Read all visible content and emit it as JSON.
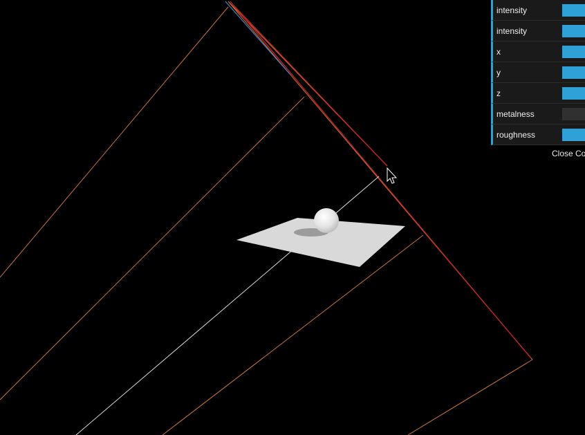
{
  "controls": [
    {
      "label": "intensity",
      "fill": 1.0
    },
    {
      "label": "intensity",
      "fill": 1.0
    },
    {
      "label": "x",
      "fill": 1.0
    },
    {
      "label": "y",
      "fill": 1.0
    },
    {
      "label": "z",
      "fill": 1.0
    },
    {
      "label": "metalness",
      "fill": 0.0
    },
    {
      "label": "roughness",
      "fill": 1.0
    }
  ],
  "close_label": "Close Co",
  "colors": {
    "accent": "#2fa1d6",
    "panel_bg": "#1a1a1a",
    "slider_track": "#303030",
    "helper_orange": "#c8743a",
    "helper_red": "#cc2222",
    "helper_white": "#dddddd",
    "helper_blue": "#4a7fc0",
    "plane": "#d9d9d9"
  }
}
